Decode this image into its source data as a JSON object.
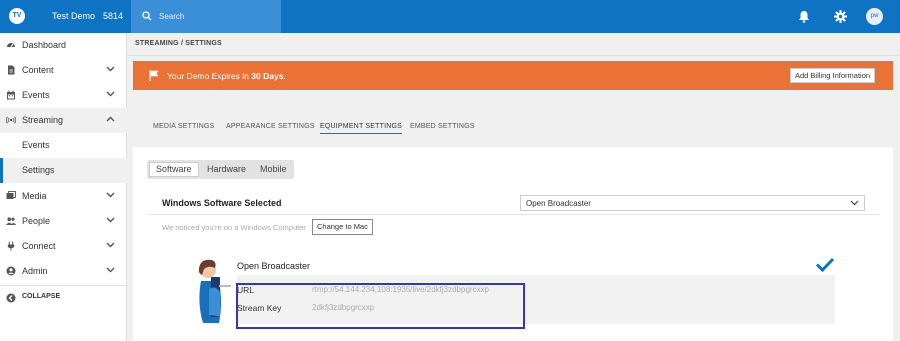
{
  "header": {
    "logo_text": "TV",
    "account_name": "Test Demo",
    "account_id": "5814",
    "search_placeholder": "Search",
    "avatar_initials": "pw"
  },
  "sidebar": {
    "items": [
      {
        "label": "Dashboard",
        "icon": "dashboard-icon"
      },
      {
        "label": "Content",
        "icon": "document-icon"
      },
      {
        "label": "Events",
        "icon": "calendar-icon"
      },
      {
        "label": "Streaming",
        "icon": "broadcast-icon"
      },
      {
        "label": "Media",
        "icon": "media-icon"
      },
      {
        "label": "People",
        "icon": "people-icon"
      },
      {
        "label": "Connect",
        "icon": "plug-icon"
      },
      {
        "label": "Admin",
        "icon": "admin-icon"
      }
    ],
    "streaming_sub": [
      "Events",
      "Settings"
    ],
    "collapse_label": "COLLAPSE"
  },
  "breadcrumb": "STREAMING / SETTINGS",
  "banner": {
    "text_prefix": "Your Demo Expires in",
    "days": "30 Days",
    "text_suffix": ".",
    "button": "Add Billing Information",
    "color": "#ea7236"
  },
  "settings_tabs": [
    "MEDIA SETTINGS",
    "APPEARANCE SETTINGS",
    "EQUIPMENT SETTINGS",
    "EMBED SETTINGS"
  ],
  "active_tab": "EQUIPMENT SETTINGS",
  "equipment": {
    "segments": [
      "Software",
      "Hardware",
      "Mobile"
    ],
    "active_segment": "Software",
    "section_title": "Windows Software Selected",
    "select_value": "Open Broadcaster",
    "notice": "We noticed you're on a Windows Computer",
    "change_button": "Change to Mac",
    "software_name": "Open Broadcaster",
    "url_label": "URL",
    "url_value": "rtmp://54.144.234.108:1935/live/2dkfj3zdbpgrcxxp",
    "key_label": "Stream Key",
    "key_value": "2dkfj3zdbpgrcxxp"
  },
  "colors": {
    "primary": "#0f73c4",
    "highlight_border": "#3535b8",
    "check": "#0f73c4"
  }
}
